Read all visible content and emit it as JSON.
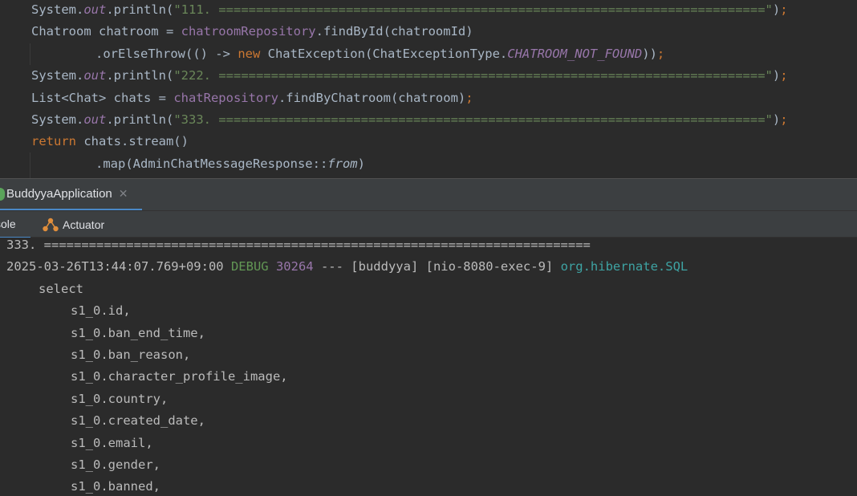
{
  "editor": {
    "lines": [
      {
        "indent": 39,
        "tokens": [
          [
            "t-default",
            "System."
          ],
          [
            "t-field",
            "out"
          ],
          [
            "t-default",
            ".println("
          ],
          [
            "t-str",
            "\"111. =========================================================================\""
          ],
          [
            "t-default",
            ")"
          ],
          [
            "t-punct",
            ";"
          ]
        ]
      },
      {
        "indent": 39,
        "tokens": [
          [
            "t-default",
            "Chatroom chatroom = "
          ],
          [
            "t-purple",
            "chatroomRepository"
          ],
          [
            "t-default",
            ".findById(chatroomId)"
          ]
        ]
      },
      {
        "indent": 119,
        "tokens": [
          [
            "t-default",
            ".orElseThrow(() -> "
          ],
          [
            "t-kw",
            "new "
          ],
          [
            "t-default",
            "ChatException(ChatExceptionType."
          ],
          [
            "t-const",
            "CHATROOM_NOT_FOUND"
          ],
          [
            "t-default",
            "))"
          ],
          [
            "t-punct",
            ";"
          ]
        ]
      },
      {
        "indent": 39,
        "tokens": [
          [
            "t-default",
            "System."
          ],
          [
            "t-field",
            "out"
          ],
          [
            "t-default",
            ".println("
          ],
          [
            "t-str",
            "\"222. =========================================================================\""
          ],
          [
            "t-default",
            ")"
          ],
          [
            "t-punct",
            ";"
          ]
        ]
      },
      {
        "indent": 39,
        "tokens": [
          [
            "t-default",
            "List<Chat> chats = "
          ],
          [
            "t-purple",
            "chatRepository"
          ],
          [
            "t-default",
            ".findByChatroom(chatroom)"
          ],
          [
            "t-punct",
            ";"
          ]
        ]
      },
      {
        "indent": 39,
        "tokens": [
          [
            "t-default",
            "System."
          ],
          [
            "t-field",
            "out"
          ],
          [
            "t-default",
            ".println("
          ],
          [
            "t-str",
            "\"333. =========================================================================\""
          ],
          [
            "t-default",
            ")"
          ],
          [
            "t-punct",
            ";"
          ]
        ]
      },
      {
        "indent": 39,
        "tokens": [
          [
            "t-kw",
            "return "
          ],
          [
            "t-default",
            "chats.stream()"
          ]
        ]
      },
      {
        "indent": 119,
        "tokens": [
          [
            "t-default",
            ".map(AdminChatMessageResponse::"
          ],
          [
            "t-ital",
            "from"
          ],
          [
            "t-default",
            ")"
          ]
        ]
      }
    ]
  },
  "run_panel": {
    "tab_label": "BuddyyaApplication",
    "close_glyph": "✕",
    "console_tab_label": "sole",
    "actuator_tab_label": "Actuator"
  },
  "console": {
    "lines": [
      {
        "indent": 0,
        "tokens": [
          [
            "",
            "333. ========================================================================="
          ]
        ]
      },
      {
        "indent": 0,
        "tokens": [
          [
            "",
            "2025-03-26T13:44:07.769+09:00 "
          ],
          [
            "c-debug",
            "DEBUG "
          ],
          [
            "c-pid",
            "30264"
          ],
          [
            "",
            " --- [buddyya] [nio-8080-exec-9] "
          ],
          [
            "c-logger",
            "org.hibernate.SQL"
          ]
        ]
      },
      {
        "indent": 40,
        "tokens": [
          [
            "",
            "select"
          ]
        ]
      },
      {
        "indent": 80,
        "tokens": [
          [
            "",
            "s1_0.id,"
          ]
        ]
      },
      {
        "indent": 80,
        "tokens": [
          [
            "",
            "s1_0.ban_end_time,"
          ]
        ]
      },
      {
        "indent": 80,
        "tokens": [
          [
            "",
            "s1_0.ban_reason,"
          ]
        ]
      },
      {
        "indent": 80,
        "tokens": [
          [
            "",
            "s1_0.character_profile_image,"
          ]
        ]
      },
      {
        "indent": 80,
        "tokens": [
          [
            "",
            "s1_0.country,"
          ]
        ]
      },
      {
        "indent": 80,
        "tokens": [
          [
            "",
            "s1_0.created_date,"
          ]
        ]
      },
      {
        "indent": 80,
        "tokens": [
          [
            "",
            "s1_0.email,"
          ]
        ]
      },
      {
        "indent": 80,
        "tokens": [
          [
            "",
            "s1_0.gender,"
          ]
        ]
      },
      {
        "indent": 80,
        "tokens": [
          [
            "",
            "s1_0.banned,"
          ]
        ]
      }
    ]
  },
  "colors": {
    "editor_bg": "#2b2b2b",
    "panel_bg": "#3c3f41",
    "accent": "#4a88c7"
  }
}
